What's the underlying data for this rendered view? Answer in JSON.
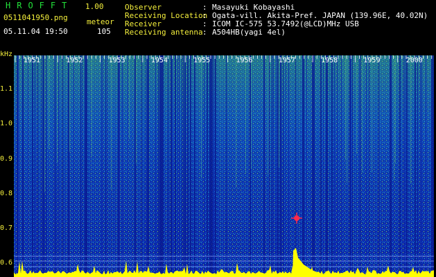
{
  "header": {
    "app_title": "HROFFT",
    "app_version": "1.00",
    "file_name": "0511041950.png",
    "mode": "meteor",
    "timestamp": "05.11.04 19:50",
    "count": "105"
  },
  "info": [
    {
      "label": "Observer",
      "value": "Masayuki Kobayashi"
    },
    {
      "label": "Receiving Location",
      "value": "Ogata-vill. Akita-Pref. JAPAN (139.96E, 40.02N)"
    },
    {
      "label": "Receiver",
      "value": "ICOM IC-575 53.7492(@LCD)MHz USB"
    },
    {
      "label": "Receiving antenna",
      "value": "A504HB(yagi 4el)"
    }
  ],
  "spectrogram": {
    "y_unit": "kHz",
    "y_ticks": [
      "1.1",
      "1.0",
      "0.9",
      "0.8",
      "0.7",
      "0.6"
    ],
    "time_labels": [
      "1951",
      "1952",
      "1953",
      "1954",
      "1955",
      "1956",
      "1957",
      "1958",
      "1959",
      "2000"
    ],
    "meteor_detected_at": "1957",
    "colors": {
      "background": "#0a1890",
      "noise_low": "#1236c8",
      "noise_mid": "#19a8b8",
      "noise_high": "#8fe04a",
      "signal": "#ffff00",
      "meteor": "#ff2a4a",
      "axis_label": "#f4ef3c"
    }
  }
}
